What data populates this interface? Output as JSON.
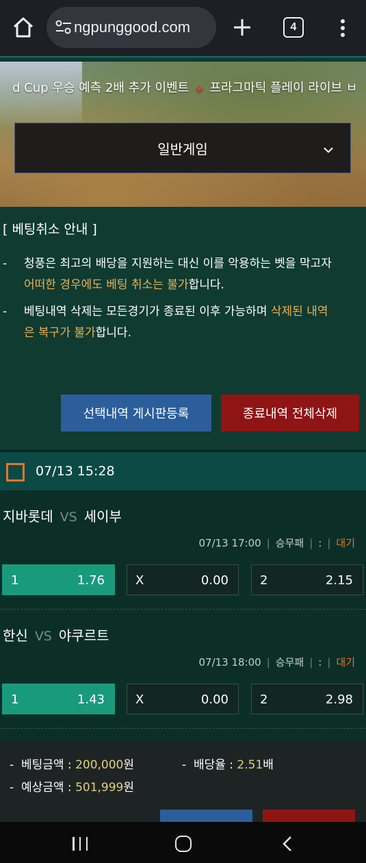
{
  "browser": {
    "url": "ngpunggood.com",
    "tab_count": "4"
  },
  "hero": {
    "marquee_part1": "d Cup 우승 예측 2배 추가 이벤트",
    "marquee_part2": "프라그마틱 플레이 라이브 ㅂ",
    "game_select": "일반게임"
  },
  "notice": {
    "title": "[  베팅취소 안내  ]",
    "dash": "-",
    "item1_line1": "청풍은 최고의 배당을 지원하는 대신 이를 악용하는 벳을 막고자",
    "item1_highlight": "어떠한 경우에도 베팅 취소는 불가",
    "item1_tail": "합니다.",
    "item2_line1": "베팅내역 삭제는 모든경기가 종료된 이후 가능하며 ",
    "item2_highlight1": "삭제된 내역",
    "item2_highlight2": "은 복구가 불가",
    "item2_tail": "합니다.",
    "btn_register": "선택내역 게시판등록",
    "btn_delete": "종료내역 전체삭제"
  },
  "slip": {
    "date": "07/13 15:28"
  },
  "matches": [
    {
      "home": "지바롯데",
      "vs": "VS",
      "away": "세이부",
      "time": "07/13 17:00",
      "type": "승무패",
      "score": ":",
      "status": "대기",
      "odds": [
        {
          "label": "1",
          "value": "1.76"
        },
        {
          "label": "X",
          "value": "0.00"
        },
        {
          "label": "2",
          "value": "2.15"
        }
      ]
    },
    {
      "home": "한신",
      "vs": "VS",
      "away": "야쿠르트",
      "time": "07/13 18:00",
      "type": "승무패",
      "score": ":",
      "status": "대기",
      "odds": [
        {
          "label": "1",
          "value": "1.43"
        },
        {
          "label": "X",
          "value": "0.00"
        },
        {
          "label": "2",
          "value": "2.98"
        }
      ]
    }
  ],
  "summary": {
    "dash": "-",
    "bet_amount_label": "베팅금액 : ",
    "bet_amount_value": "200,000",
    "won": "원",
    "odds_label": "배당율 : ",
    "odds_value": "2.51",
    "odds_unit": "배",
    "expected_label": "예상금액 : ",
    "expected_value": "501,999"
  },
  "colors": {
    "accent_orange": "#e3772a",
    "highlight": "#e8b25a",
    "selected_odd": "#1a9a7c",
    "btn_blue": "#2b5e9b",
    "btn_red": "#8f1414"
  },
  "icons": [
    "home-icon",
    "site-settings-icon",
    "new-tab-plus-icon",
    "tab-switcher-icon",
    "more-menu-icon",
    "chevron-down-icon",
    "checkbox-icon",
    "recent-apps-icon",
    "nav-home-icon",
    "back-icon"
  ]
}
